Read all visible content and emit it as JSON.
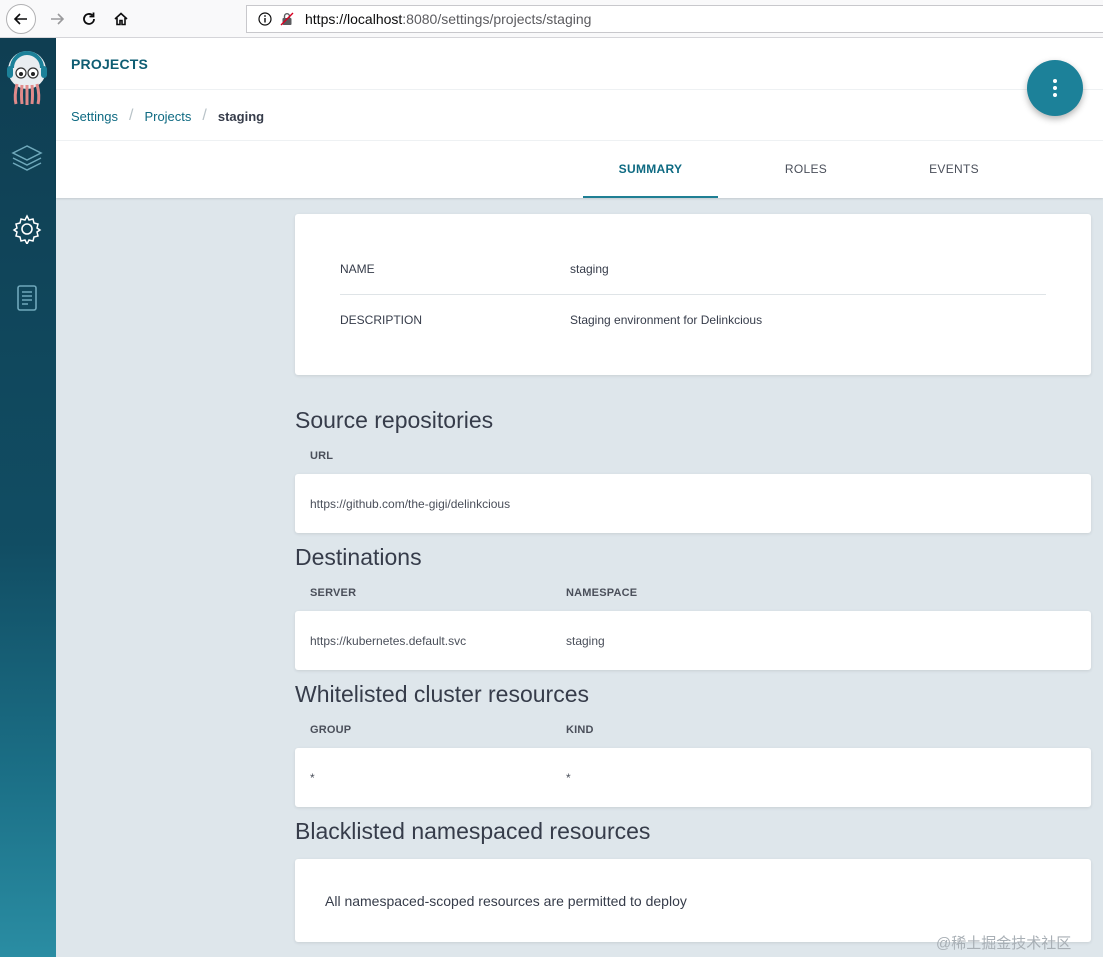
{
  "browser": {
    "url_prefix": "https://",
    "url_host": "localhost",
    "url_rest": ":8080/settings/projects/staging"
  },
  "header": {
    "title": "PROJECTS",
    "breadcrumb": [
      "Settings",
      "Projects",
      "staging"
    ],
    "tabs": [
      {
        "label": "SUMMARY",
        "active": true
      },
      {
        "label": "ROLES",
        "active": false
      },
      {
        "label": "EVENTS",
        "active": false
      }
    ]
  },
  "summary": {
    "name_label": "NAME",
    "name_value": "staging",
    "description_label": "DESCRIPTION",
    "description_value": "Staging environment for Delinkcious"
  },
  "source_repositories": {
    "title": "Source repositories",
    "columns": [
      "URL"
    ],
    "rows": [
      [
        "https://github.com/the-gigi/delinkcious"
      ]
    ]
  },
  "destinations": {
    "title": "Destinations",
    "columns": [
      "SERVER",
      "NAMESPACE"
    ],
    "rows": [
      [
        "https://kubernetes.default.svc",
        "staging"
      ]
    ]
  },
  "whitelisted": {
    "title": "Whitelisted cluster resources",
    "columns": [
      "GROUP",
      "KIND"
    ],
    "rows": [
      [
        "*",
        "*"
      ]
    ]
  },
  "blacklisted": {
    "title": "Blacklisted namespaced resources",
    "message": "All namespaced-scoped resources are permitted to deploy"
  },
  "watermark": "@稀土掘金技术社区",
  "colors": {
    "accent": "#1c8199",
    "sidebar": "#0f3e52",
    "background": "#dee6eb"
  },
  "icons": {
    "sidebar": [
      "argo-logo",
      "layers-icon",
      "gear-icon",
      "docs-icon"
    ],
    "fab": "more-vertical-icon"
  }
}
